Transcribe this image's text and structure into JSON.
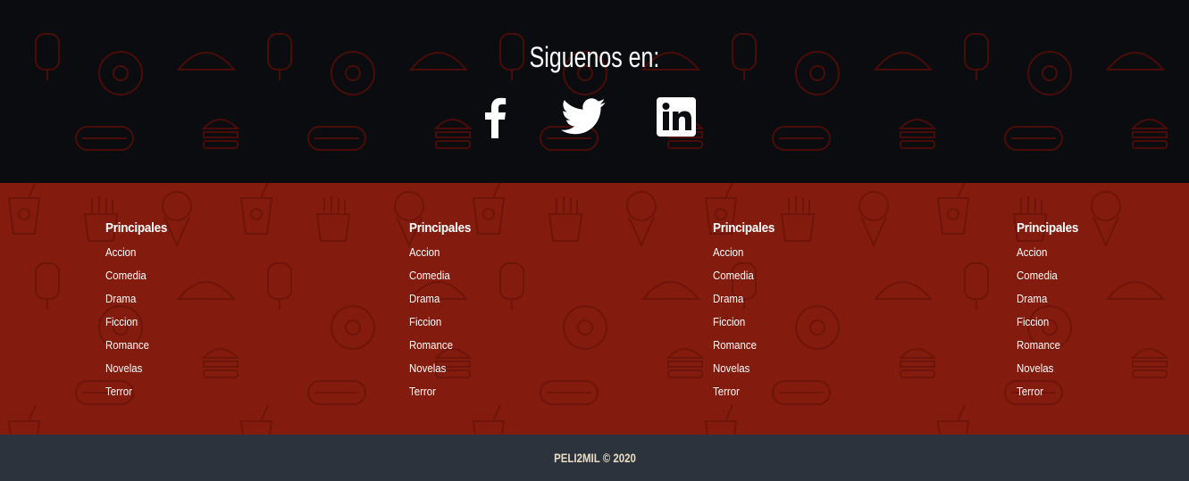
{
  "social": {
    "title": "Siguenos en:",
    "icons": [
      "facebook-icon",
      "twitter-icon",
      "linkedin-icon"
    ]
  },
  "columns": [
    {
      "title": "Principales",
      "items": [
        "Accion",
        "Comedia",
        "Drama",
        "Ficcion",
        "Romance",
        "Novelas",
        "Terror"
      ]
    },
    {
      "title": "Principales",
      "items": [
        "Accion",
        "Comedia",
        "Drama",
        "Ficcion",
        "Romance",
        "Novelas",
        "Terror"
      ]
    },
    {
      "title": "Principales",
      "items": [
        "Accion",
        "Comedia",
        "Drama",
        "Ficcion",
        "Romance",
        "Novelas",
        "Terror"
      ]
    },
    {
      "title": "Principales",
      "items": [
        "Accion",
        "Comedia",
        "Drama",
        "Ficcion",
        "Romance",
        "Novelas",
        "Terror"
      ]
    }
  ],
  "footer": {
    "copyright": "PELI2MIL © 2020"
  },
  "colors": {
    "social_bg": "#0b0c0f",
    "links_bg": "#831b0e",
    "copyright_bg": "#2c333d",
    "pattern": "#5a0e0a"
  }
}
